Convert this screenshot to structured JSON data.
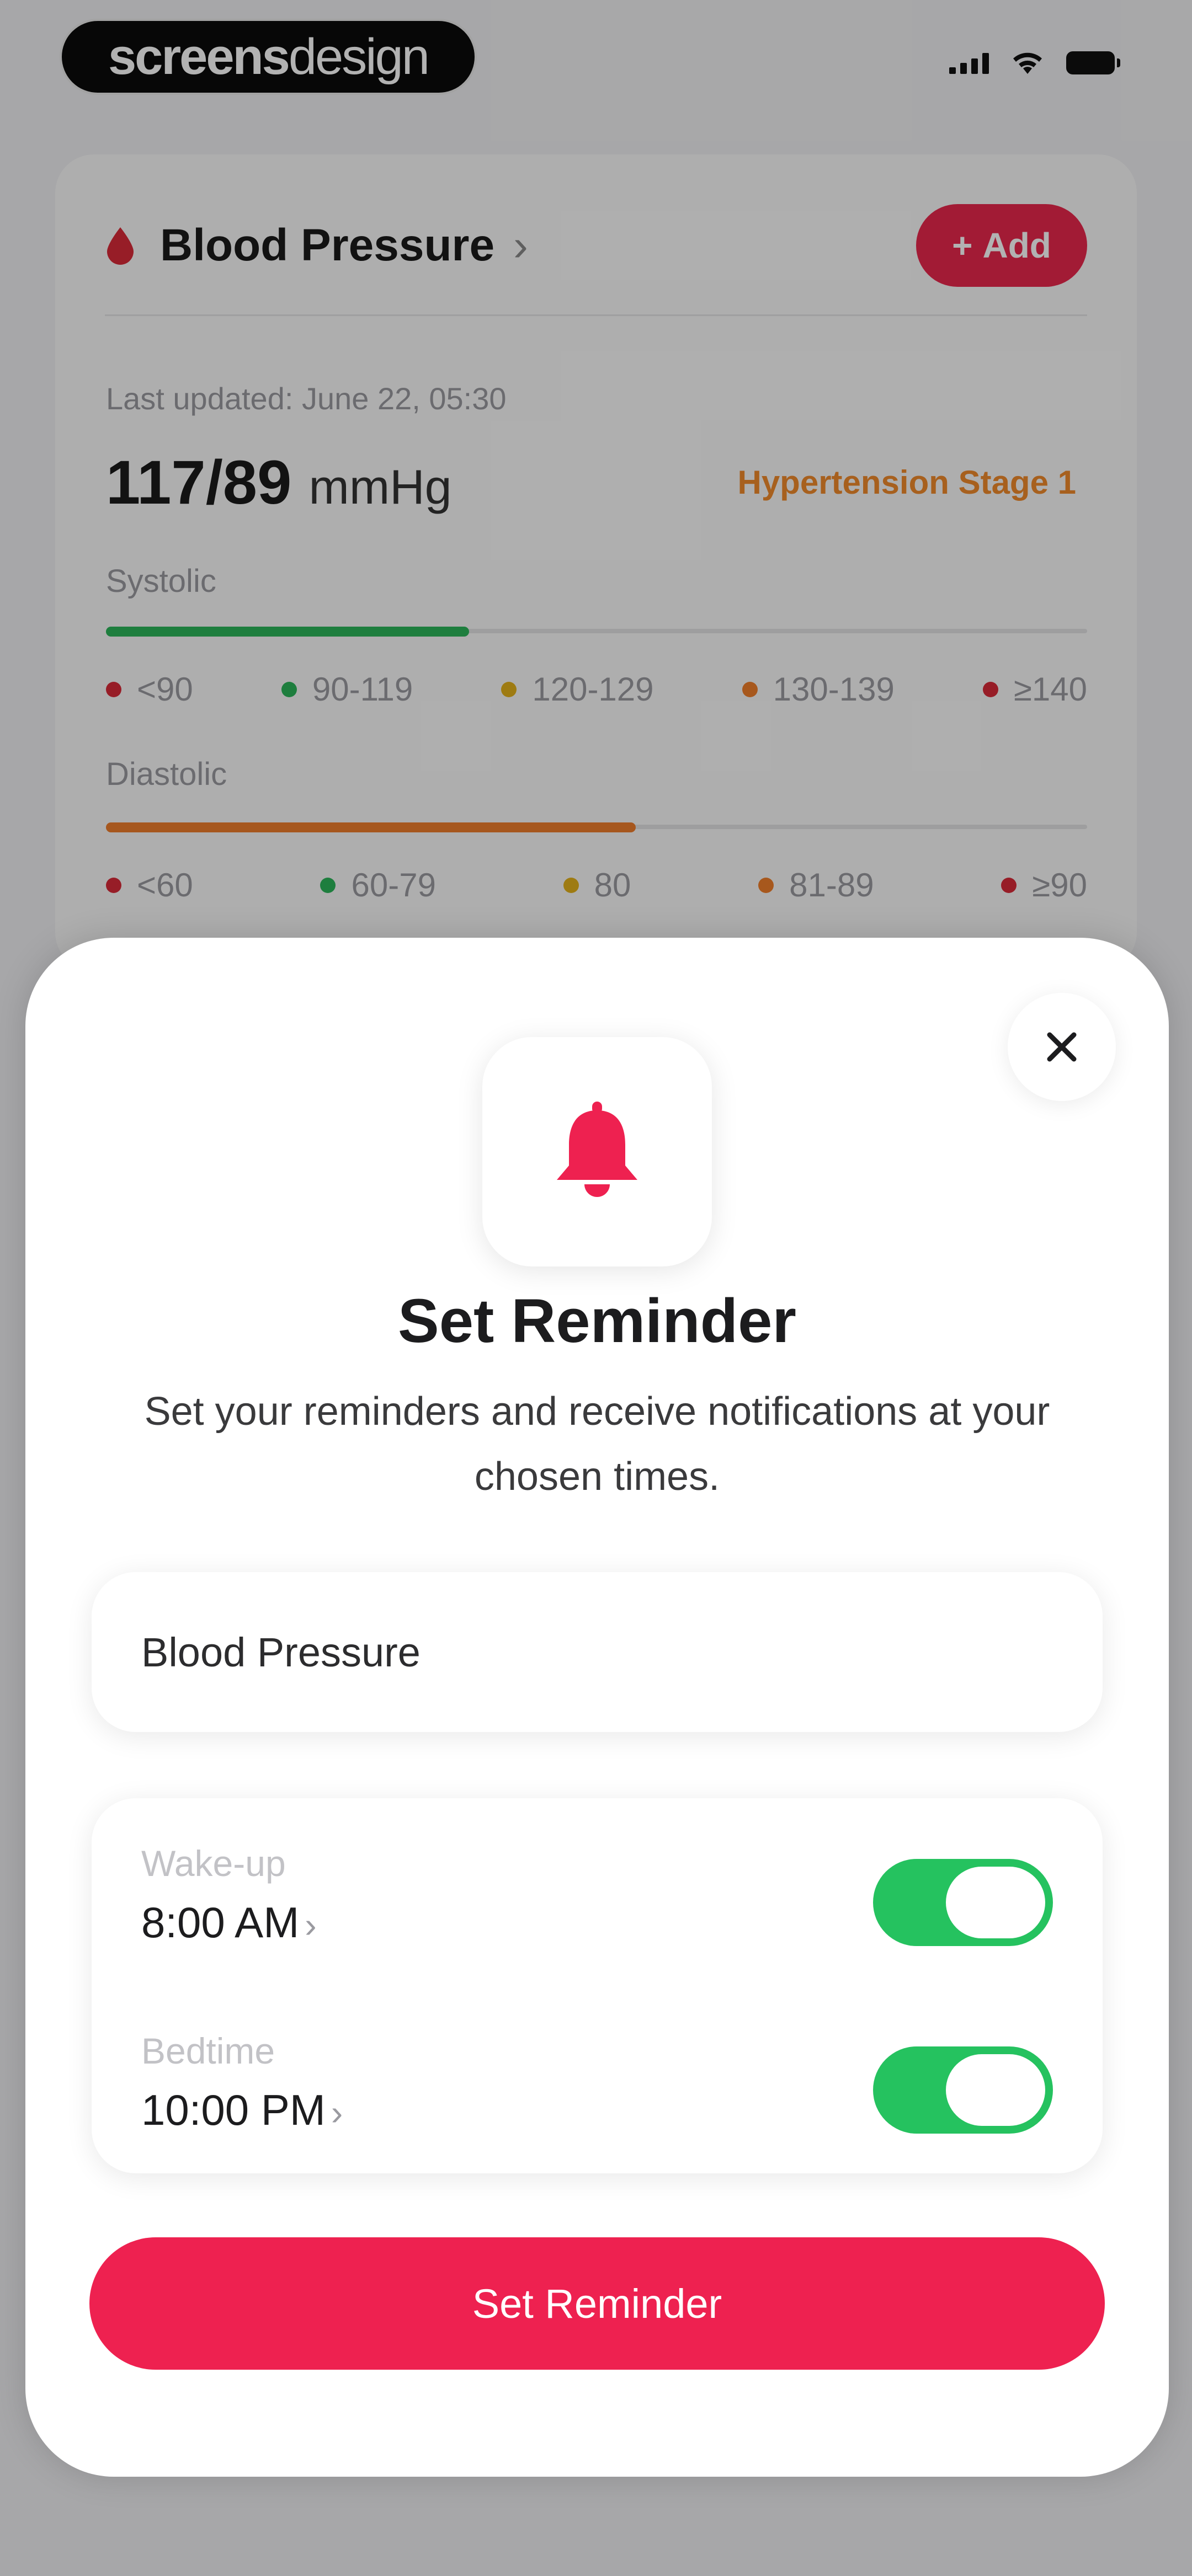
{
  "status_bar": {
    "brand_bold": "screens",
    "brand_light": "design"
  },
  "blood_pressure_card": {
    "title": "Blood Pressure",
    "add_label": "Add",
    "last_updated": "Last updated: June 22, 05:30",
    "reading_value": "117/89",
    "reading_unit": "mmHg",
    "stage": "Hypertension Stage 1",
    "systolic": {
      "label": "Systolic",
      "level": 0.37,
      "legend": [
        "<90",
        "90-119",
        "120-129",
        "130-139",
        "≥140"
      ]
    },
    "diastolic": {
      "label": "Diastolic",
      "level": 0.54,
      "legend": [
        "<60",
        "60-79",
        "80",
        "81-89",
        "≥90"
      ]
    }
  },
  "colors": {
    "accent": "#ee2150",
    "toggle_on": "#25c25f",
    "systolic_fill": "#2bb55a",
    "diastolic_fill": "#ee7d2c",
    "stage_text": "#f08a2c",
    "legend_red": "#d92a38",
    "legend_green": "#2bb55a",
    "legend_yellow": "#e2b11b",
    "legend_orange": "#f07e2a"
  },
  "reminder_sheet": {
    "title": "Set Reminder",
    "description": "Set your reminders and receive notifications at your chosen times.",
    "type_value": "Blood Pressure",
    "times": [
      {
        "label": "Wake-up",
        "time": "8:00 AM",
        "enabled": true
      },
      {
        "label": "Bedtime",
        "time": "10:00 PM",
        "enabled": true
      }
    ],
    "submit_label": "Set Reminder"
  }
}
